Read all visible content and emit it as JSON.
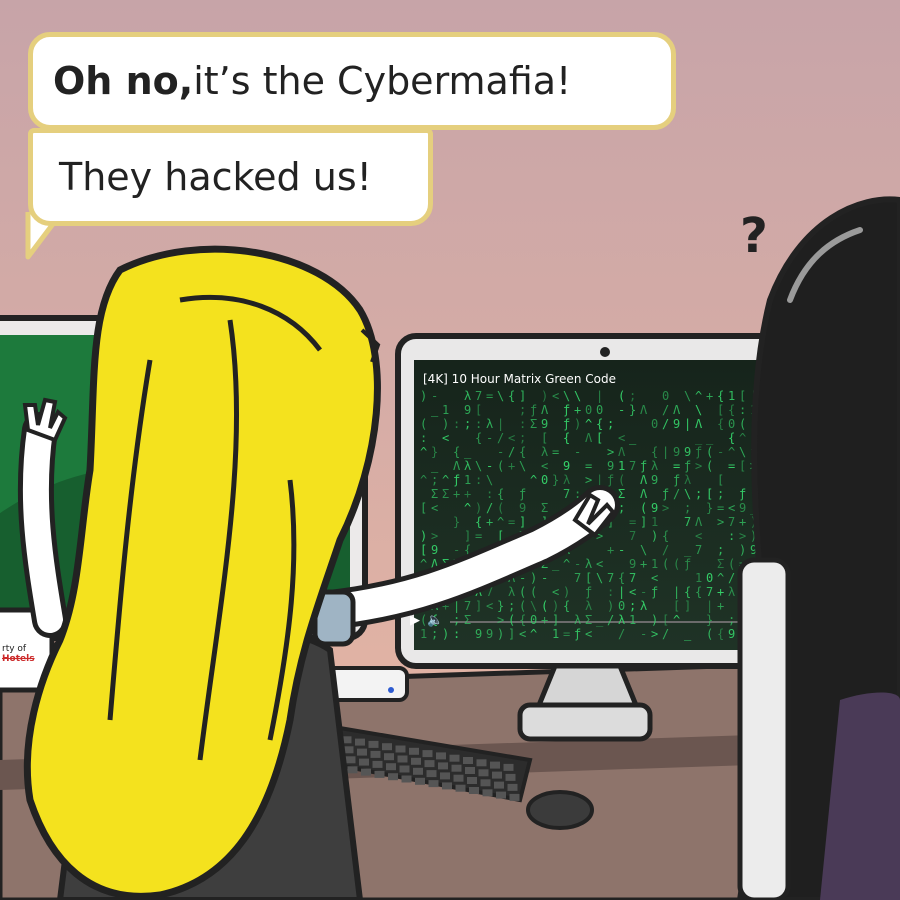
{
  "speech": {
    "bubble_1_bold": "Oh no,",
    "bubble_1_rest": " it’s the Cybermafia!",
    "bubble_2": "They hacked us!"
  },
  "screen": {
    "video_title": "[4K] 10 Hour Matrix Green Code",
    "play_icon": "play-icon",
    "volume_icon": "volume-icon"
  },
  "mug": {
    "line_1": "rty of",
    "line_2": "Hotels"
  },
  "confused_mark": "?",
  "colors": {
    "background_top": "#c9a7aa",
    "background_bottom": "#e6b4a2",
    "bubble_border": "#e5cf7e",
    "matrix_green": "#35d36a",
    "blonde_hair": "#f4e21e",
    "dark_hair": "#1f1f1f",
    "desk": "#8a7068"
  }
}
